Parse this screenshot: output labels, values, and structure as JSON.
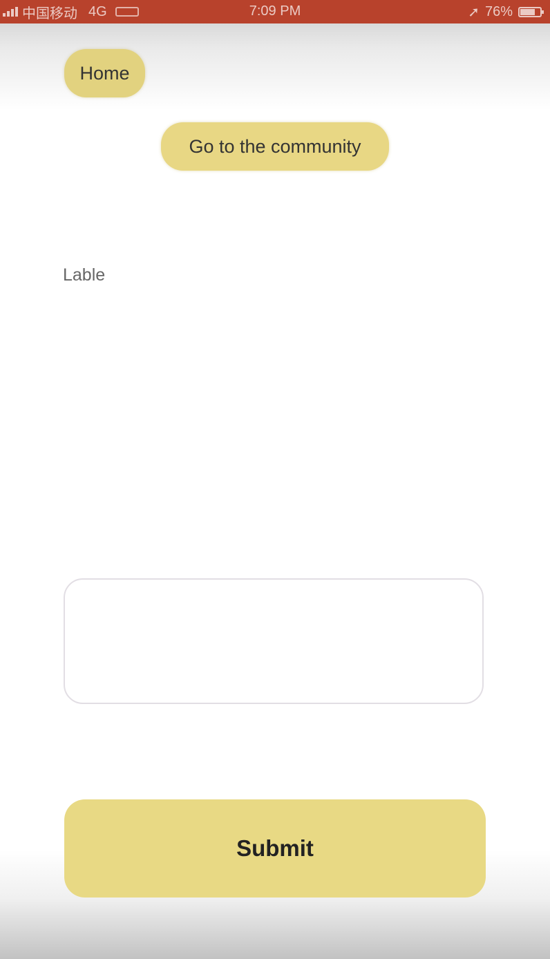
{
  "status_bar": {
    "carrier": "中国移动",
    "network": "4G",
    "clock": "7:09 PM",
    "battery_text": "76%",
    "battery_level": 0.76,
    "bg_color": "#b8422c"
  },
  "nav": {
    "home_label": "Home",
    "community_label": "Go to the community"
  },
  "form": {
    "label_text": "Lable",
    "text_area_value": "",
    "submit_label": "Submit"
  },
  "colors": {
    "accent": "#e8d784"
  }
}
